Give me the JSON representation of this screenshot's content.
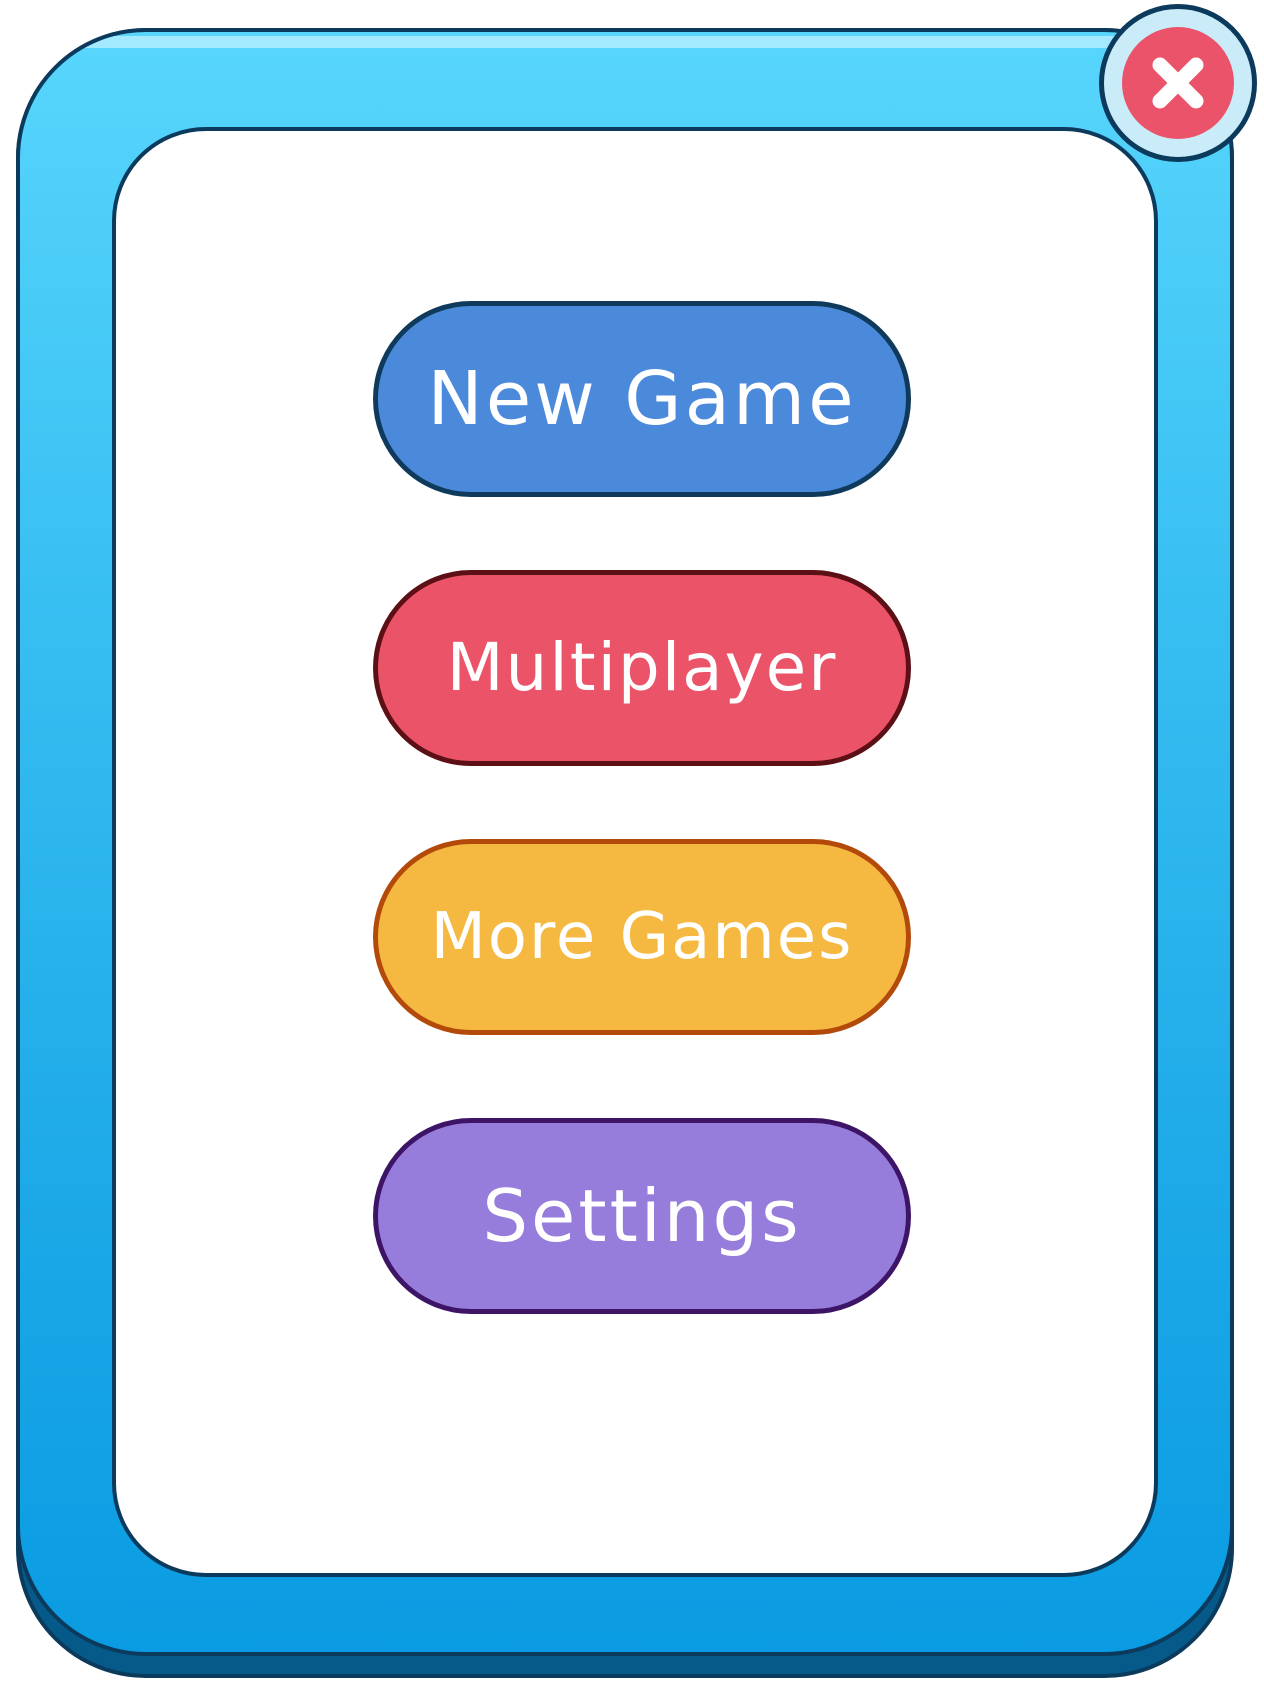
{
  "window": {
    "frame_color": "#2ab4ec",
    "panel_color": "#ffffff",
    "outline_color": "#0b3a5c"
  },
  "close_button": {
    "icon": "close-icon",
    "color": "#ea5369"
  },
  "menu": {
    "buttons": [
      {
        "label": "New Game",
        "color": "#4b8adb",
        "border": "#0f3a5c"
      },
      {
        "label": "Multiplayer",
        "color": "#eb5468",
        "border": "#5c0f14"
      },
      {
        "label": "More Games",
        "color": "#f5b942",
        "border": "#b34a0a"
      },
      {
        "label": "Settings",
        "color": "#967ddb",
        "border": "#3d1466"
      }
    ]
  }
}
